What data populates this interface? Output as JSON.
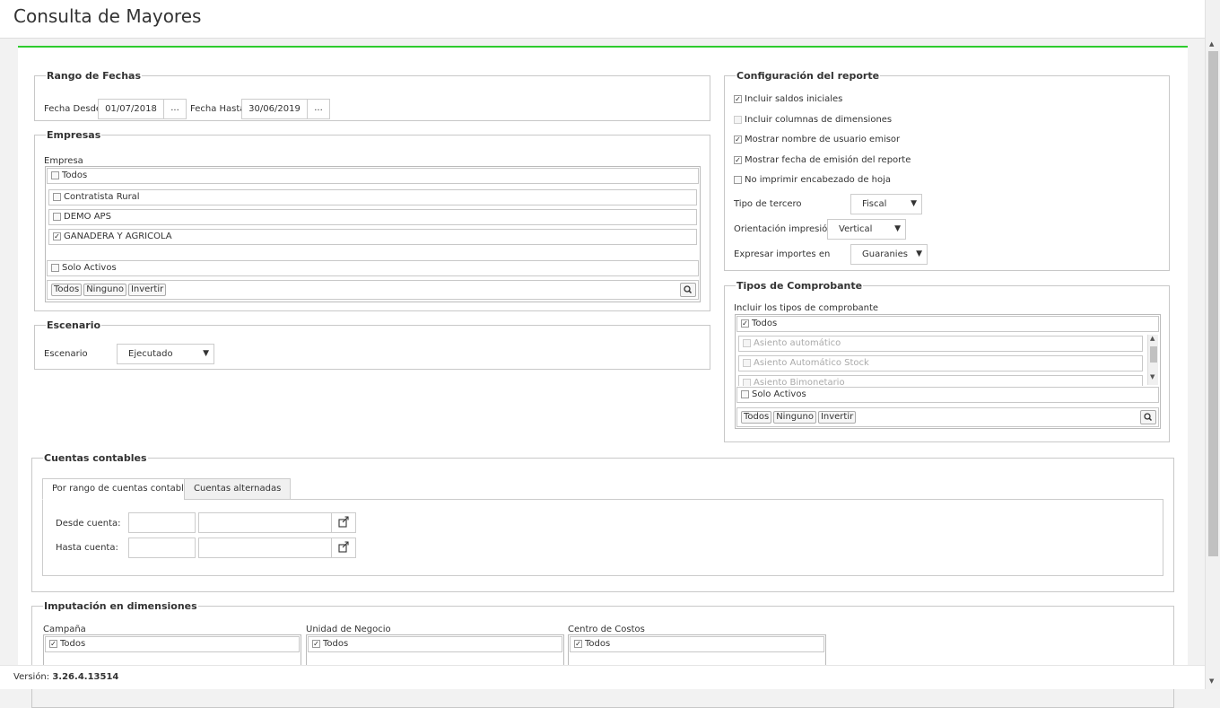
{
  "title": "Consulta de Mayores",
  "rango_fechas": {
    "legend": "Rango de Fechas",
    "desde_label": "Fecha Desde",
    "desde_value": "01/07/2018",
    "hasta_label": "Fecha Hasta",
    "hasta_value": "30/06/2019",
    "picker_label": "..."
  },
  "empresas": {
    "legend": "Empresas",
    "label": "Empresa",
    "todos": "Todos",
    "items": [
      {
        "label": "Contratista Rural",
        "checked": false
      },
      {
        "label": "DEMO APS",
        "checked": false
      },
      {
        "label": "GANADERA Y AGRICOLA",
        "checked": true
      }
    ],
    "solo_activos": "Solo Activos",
    "btn_todos": "Todos",
    "btn_ninguno": "Ninguno",
    "btn_invertir": "Invertir"
  },
  "escenario": {
    "legend": "Escenario",
    "label": "Escenario",
    "value": "Ejecutado"
  },
  "config": {
    "legend": "Configuración del reporte",
    "checks": [
      {
        "label": "Incluir saldos iniciales",
        "checked": true
      },
      {
        "label": "Incluir columnas de dimensiones",
        "checked": false,
        "disabled": true
      },
      {
        "label": "Mostrar nombre de usuario emisor",
        "checked": true
      },
      {
        "label": "Mostrar fecha de emisión del reporte",
        "checked": true
      },
      {
        "label": "No imprimir encabezado de hoja",
        "checked": false
      }
    ],
    "tipo_tercero_label": "Tipo de tercero",
    "tipo_tercero_value": "Fiscal",
    "orientacion_label": "Orientación impresión",
    "orientacion_value": "Vertical",
    "expresar_label": "Expresar importes en",
    "expresar_value": "Guaranies"
  },
  "tipos": {
    "legend": "Tipos de Comprobante",
    "label": "Incluir los tipos de comprobante",
    "todos": "Todos",
    "items": [
      "Asiento automático",
      "Asiento Automático Stock",
      "Asiento Bimonetario"
    ],
    "solo_activos": "Solo Activos",
    "btn_todos": "Todos",
    "btn_ninguno": "Ninguno",
    "btn_invertir": "Invertir"
  },
  "cuentas": {
    "legend": "Cuentas contables",
    "tab_rango": "Por rango de cuentas contables",
    "tab_alternadas": "Cuentas alternadas",
    "desde_label": "Desde cuenta:",
    "hasta_label": "Hasta cuenta:"
  },
  "imputacion": {
    "legend": "Imputación en dimensiones",
    "columns": [
      {
        "label": "Campaña",
        "todos": "Todos"
      },
      {
        "label": "Unidad de Negocio",
        "todos": "Todos"
      },
      {
        "label": "Centro de Costos",
        "todos": "Todos"
      }
    ]
  },
  "footer": {
    "version_label": "Versión:",
    "version_value": "3.26.4.13514"
  },
  "colors": {
    "accent": "#2ecc2e"
  }
}
